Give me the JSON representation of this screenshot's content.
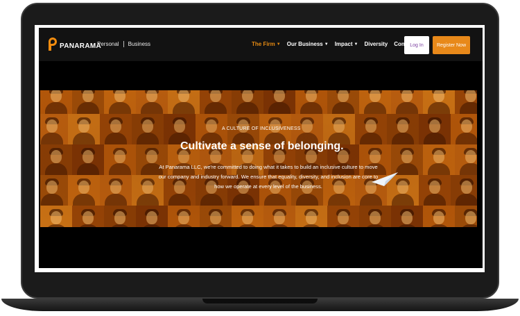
{
  "nav": {
    "logo_text": "PANARAMA",
    "segments": [
      "Personal",
      "Business"
    ],
    "menu": [
      {
        "label": "The Firm",
        "has_dropdown": true,
        "active": true
      },
      {
        "label": "Our Business",
        "has_dropdown": true,
        "active": false
      },
      {
        "label": "Impact",
        "has_dropdown": true,
        "active": false
      },
      {
        "label": "Diversity",
        "has_dropdown": false,
        "active": false
      },
      {
        "label": "Contact",
        "has_dropdown": false,
        "active": false
      }
    ],
    "login_label": "Log In",
    "register_label": "Register Now"
  },
  "hero": {
    "eyebrow": "A CULTURE OF INCLUSIVENESS",
    "headline": "Cultivate a sense of belonging.",
    "body": "At Panarama LLC, we're committed to doing what it takes to build an inclusive culture to move our company and industry forward. We ensure that equality, diversity, and inclusion are core to how we operate at every level of the business."
  },
  "colors": {
    "accent": "#e8891a",
    "nav_bg": "#121212",
    "hero_tint": "#8a3d06",
    "login_text": "#7b3fa0"
  }
}
